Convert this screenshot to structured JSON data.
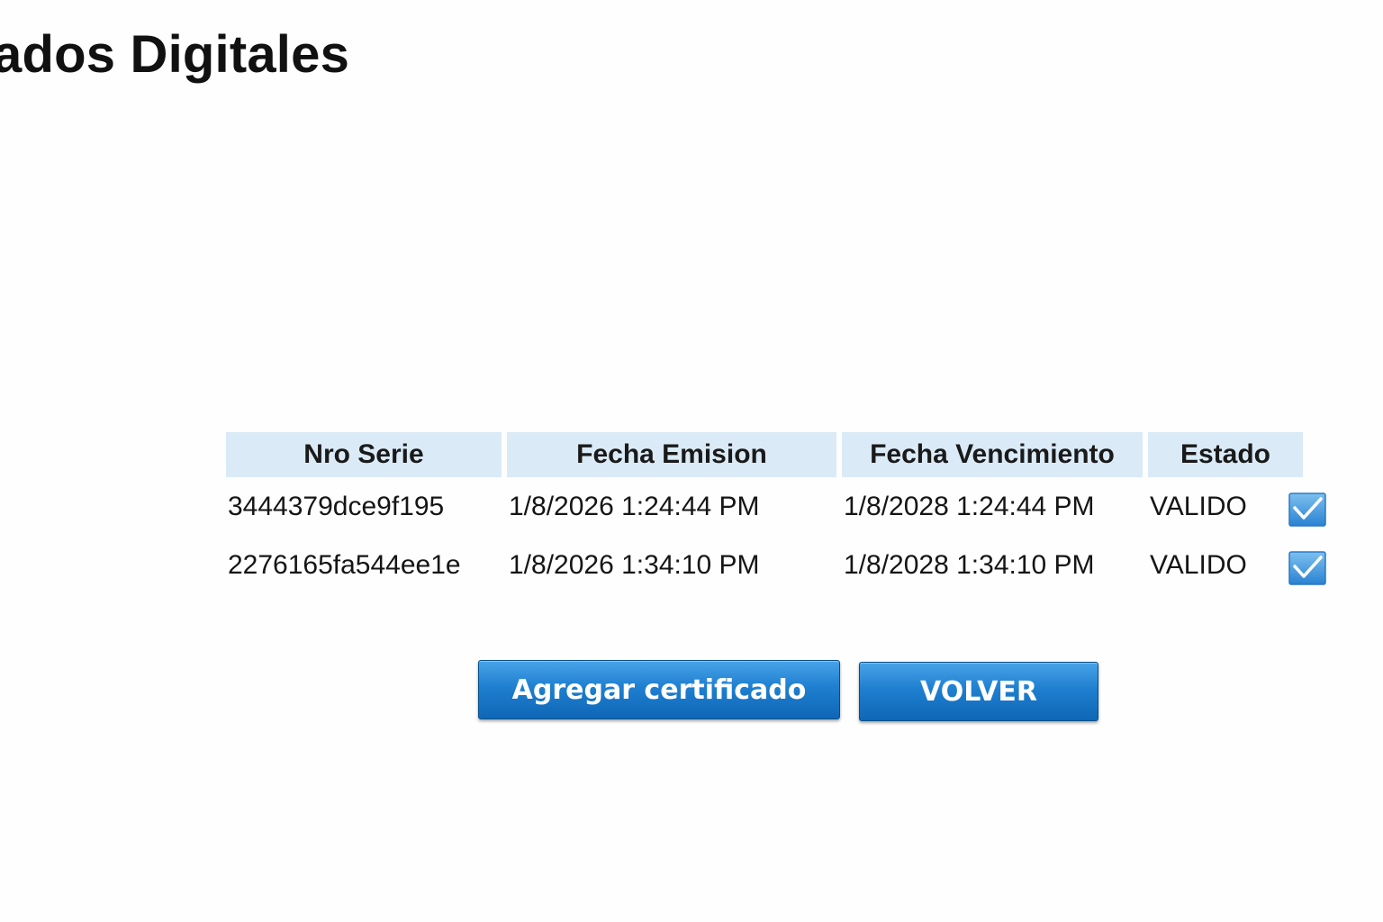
{
  "page": {
    "title": "ados Digitales"
  },
  "table": {
    "headers": {
      "serie": "Nro Serie",
      "emision": "Fecha Emision",
      "vencimiento": "Fecha Vencimiento",
      "estado": "Estado"
    },
    "rows": [
      {
        "serie": "3444379dce9f195",
        "emision": "1/8/2026 1:24:44 PM",
        "vencimiento": "1/8/2028 1:24:44 PM",
        "estado": "VALIDO",
        "icon": "checkbox-checked-icon"
      },
      {
        "serie": "2276165fa544ee1e",
        "emision": "1/8/2026 1:34:10 PM",
        "vencimiento": "1/8/2028 1:34:10 PM",
        "estado": "VALIDO",
        "icon": "checkbox-checked-icon"
      }
    ]
  },
  "actions": {
    "add_label": "Agregar certificado",
    "back_label": "VOLVER"
  },
  "colors": {
    "header_bg": "#daeaf7",
    "button_blue": "#1f7fd0",
    "check_blue": "#3d95dc"
  }
}
